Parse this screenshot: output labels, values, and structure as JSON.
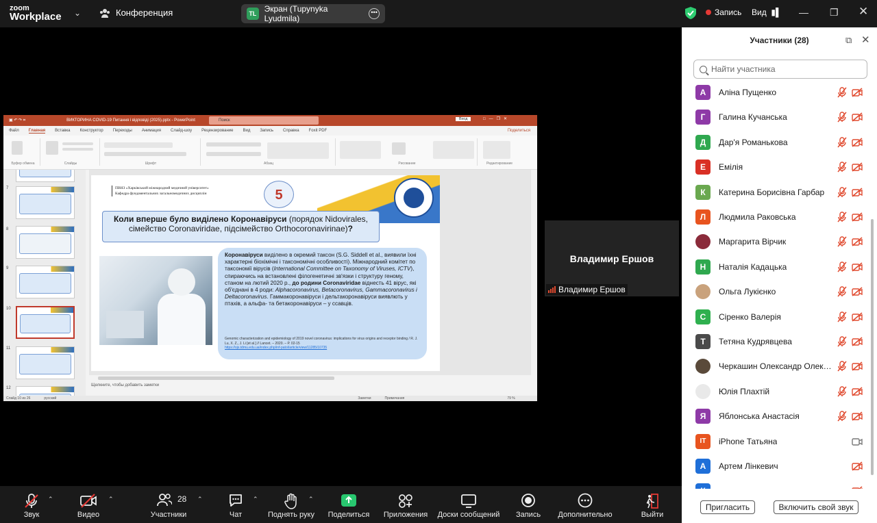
{
  "app": {
    "brand_line1": "zoom",
    "brand_line2": "Workplace"
  },
  "topbar": {
    "conference_label": "Конференция",
    "share_label": "Экран (Tupynyka Lyudmila)",
    "share_initials": "TL",
    "record_label": "Запись",
    "view_label": "Вид",
    "colors": {
      "record": "#e53935",
      "share_avatar": "#2f9e5b",
      "security": "#2ecc71"
    }
  },
  "ppt": {
    "title": "ВИКТОРИНА COVID-19 Питання і відповіді (2025).pptx - PowerPoint",
    "search": "Поиск",
    "login": "Вход",
    "tabs": [
      "Файл",
      "Главная",
      "Вставка",
      "Конструктор",
      "Переходы",
      "Анимация",
      "Слайд-шоу",
      "Рецензирование",
      "Вид",
      "Запись",
      "Справка",
      "Foxit PDF"
    ],
    "active_tab": "Главная",
    "share": "Поделиться",
    "ribbon_groups": [
      "Буфер обмена",
      "Слайды",
      "Шрифт",
      "Абзац",
      "Рисование",
      "Редактирование"
    ],
    "thumb_numbers": [
      "7",
      "8",
      "9",
      "10",
      "11",
      "12"
    ],
    "notes_placeholder": "Щелкните, чтобы добавить заметки",
    "status": {
      "slide": "Слайд 10 из 26",
      "lang": "русский",
      "notes": "Заметки",
      "comments": "Примечания",
      "zoom": "79 %"
    }
  },
  "slide": {
    "header_line1": "ПВНЗ «Харківський міжнародний медичний університет»",
    "header_line2": "Кафедра фундаментальних загальномедичних дисциплін",
    "number": "5",
    "title_bold": "Коли вперше було виділено Коронавіруси",
    "title_rest": " (порядок Nidovirales, сімейство Coronaviridae, підсімейство Orthocoronavirinae)",
    "title_q": "?",
    "body_b1": "Коронавіруси",
    "body_t1": " виділено в окремий таксон (S.G. Siddell et al., виявили їхні характерні біохімічні і таксономічні особливості). Міжнародний комітет по таксономії вірусів (",
    "body_i1": "International Committee on Taxonomy of Viruses, ICTV",
    "body_t2": "), спираючись на встановлені філогенетичні зв'язки і структуру геному, станом на лютий 2020 р., ",
    "body_b2": "до родини Coronaviridae",
    "body_t3": " віднесть 41 вірус, які об'єднані в 4 роди: ",
    "body_i2": "Alphacoronavirus, Betacoronavirus, Gammacoronavirus і Deltacoronavirus",
    "body_t4": ". Гаммакоронавіруси і дельтакоронавіруси виявлють у птахів, а альфа- та бетакоронавіруси – у ссавців.",
    "ref_text": "Genomic characterization and epidemiology of 2019 novel coronavirus: implications for virus origins and receptor binding / R. J. Lu, X. Z., J. Li [et al.] // Lancet. – 2020. – P. 02-15",
    "ref_link": "https://ojs.tdmu.edu.ua/index.php/inf-patol/article/view/11285/10735"
  },
  "speaker": {
    "name": "Владимир Ершов",
    "label": "Владимир Ершов"
  },
  "panel": {
    "title": "Участники (28)",
    "search_placeholder": "Найти участника",
    "participants": [
      {
        "initial": "А",
        "name": "Аліна Пущенко",
        "color": "#8e3aa7",
        "cam": "off"
      },
      {
        "initial": "Г",
        "name": "Галина Кучанська",
        "color": "#8e3aa7",
        "cam": "off"
      },
      {
        "initial": "Д",
        "name": "Дар'я Романькова",
        "color": "#2fa84f",
        "cam": "off"
      },
      {
        "initial": "Е",
        "name": "Емілія",
        "color": "#d93025",
        "cam": "off"
      },
      {
        "initial": "К",
        "name": "Катерина Борисівна Гарбар",
        "color": "#6aa84f",
        "cam": "off"
      },
      {
        "initial": "Л",
        "name": "Людмила Раковська",
        "color": "#e8541f",
        "cam": "off"
      },
      {
        "initial": "",
        "name": "Маргарита Вірчик",
        "color": "#8b2b3a",
        "cam": "off",
        "photo": true
      },
      {
        "initial": "Н",
        "name": "Наталія Кадацька",
        "color": "#2fa84f",
        "cam": "off"
      },
      {
        "initial": "",
        "name": "Ольга Лукієнко",
        "color": "#c9a27c",
        "cam": "off",
        "photo": true
      },
      {
        "initial": "С",
        "name": "Сіренко Валерія",
        "color": "#2fb04f",
        "cam": "off"
      },
      {
        "initial": "Т",
        "name": "Тетяна Кудрявцева",
        "color": "#4a4a4a",
        "cam": "off"
      },
      {
        "initial": "",
        "name": "Черкашин Олександр Олекса...",
        "color": "#5a4a3a",
        "cam": "off",
        "photo": true
      },
      {
        "initial": "",
        "name": "Юлія Плахтій",
        "color": "#e9e9e9",
        "cam": "off",
        "photo": true
      },
      {
        "initial": "Я",
        "name": "Яблонська Анастасія",
        "color": "#8e3aa7",
        "cam": "off"
      },
      {
        "initial": "IT",
        "name": "iPhone Татьяна",
        "color": "#e8541f",
        "cam": "on",
        "nomic": true
      },
      {
        "initial": "А",
        "name": "Артем Лінкевич",
        "color": "#1f6fd8",
        "cam": "off",
        "nomic": true
      },
      {
        "initial": "К",
        "name": "",
        "color": "#1f6fd8",
        "cam": "off",
        "nomic": true
      }
    ],
    "invite": "Пригласить",
    "unmute_me": "Включить свой звук"
  },
  "toolbar": {
    "audio": "Звук",
    "video": "Видео",
    "participants": "Участники",
    "participants_count": "28",
    "chat": "Чат",
    "raise_hand": "Поднять руку",
    "share": "Поделиться",
    "apps": "Приложения",
    "whiteboards": "Доски сообщений",
    "record": "Запись",
    "more": "Дополнительно",
    "leave": "Выйти",
    "colors": {
      "share": "#28c76f",
      "muted": "#e53935"
    }
  }
}
